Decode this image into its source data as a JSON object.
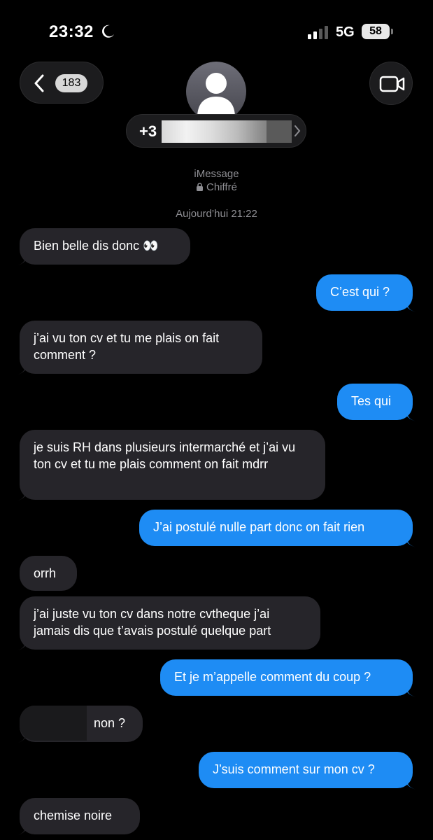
{
  "status_bar": {
    "time": "23:32",
    "network": "5G",
    "battery": "58"
  },
  "nav": {
    "back_count": "183",
    "contact_prefix": "+3",
    "service": "iMessage",
    "encryption": "Chiffré",
    "timestamp": "Aujourd’hui 21:22"
  },
  "messages": [
    {
      "side": "received",
      "text": "Bien belle dis donc 👀"
    },
    {
      "side": "sent",
      "text": "C’est qui ?"
    },
    {
      "side": "received",
      "text": "j’ai vu ton cv et tu me plais on fait comment ?"
    },
    {
      "side": "sent",
      "text": "Tes qui"
    },
    {
      "side": "received",
      "text": "je suis RH dans plusieurs intermarché et j’ai vu ton cv et tu me plais comment on fait mdrr"
    },
    {
      "side": "sent",
      "text": "J’ai postulé nulle part donc on fait rien"
    },
    {
      "side": "received",
      "text": "orrh"
    },
    {
      "side": "received",
      "text": "j’ai juste vu ton cv dans notre cvtheque j’ai jamais dis que t’avais postulé quelque part"
    },
    {
      "side": "sent",
      "text": "Et je m’appelle comment du coup ?"
    },
    {
      "side": "received",
      "text": "non ?"
    },
    {
      "side": "sent",
      "text": "J’suis comment sur mon cv ?"
    },
    {
      "side": "received",
      "text": "chemise noire"
    }
  ],
  "colors": {
    "background": "#000000",
    "received_bubble": "#26252a",
    "sent_bubble": "#1e8cf4",
    "secondary_text": "#8e8e93"
  },
  "icons": [
    "moon-icon",
    "signal-icon",
    "battery-icon",
    "chevron-left-icon",
    "video-camera-icon",
    "person-icon",
    "lock-icon",
    "chevron-right-icon"
  ]
}
